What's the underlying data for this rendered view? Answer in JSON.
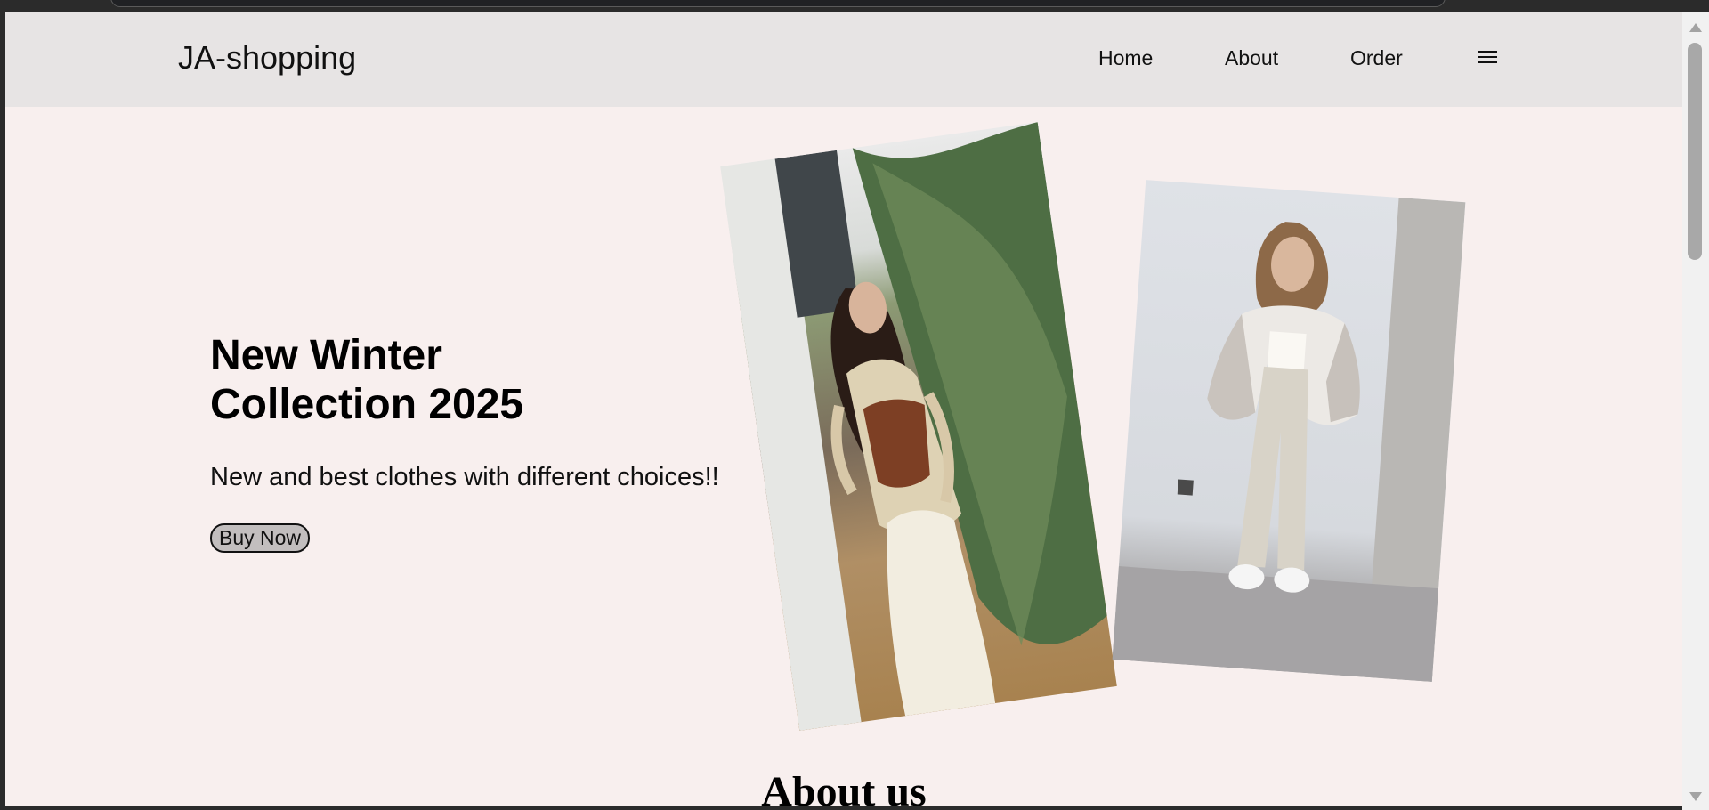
{
  "brand": {
    "name": "JA-shopping"
  },
  "nav": {
    "home": "Home",
    "about": "About",
    "order": "Order",
    "menu_icon": "hamburger-menu-icon"
  },
  "hero": {
    "title": "New Winter Collection 2025",
    "subtitle": "New and best clothes with different choices!!",
    "button": "Buy Now"
  },
  "images": {
    "left": "woman-cream-shirt-brown-corset-outdoor-photo",
    "right": "woman-plaid-jacket-beige-pants-indoor-photo"
  },
  "about": {
    "heading": "About us"
  },
  "colors": {
    "background": "#f8efee",
    "navbar": "#e7e4e4",
    "button": "#c2bebe",
    "text": "#111111"
  }
}
